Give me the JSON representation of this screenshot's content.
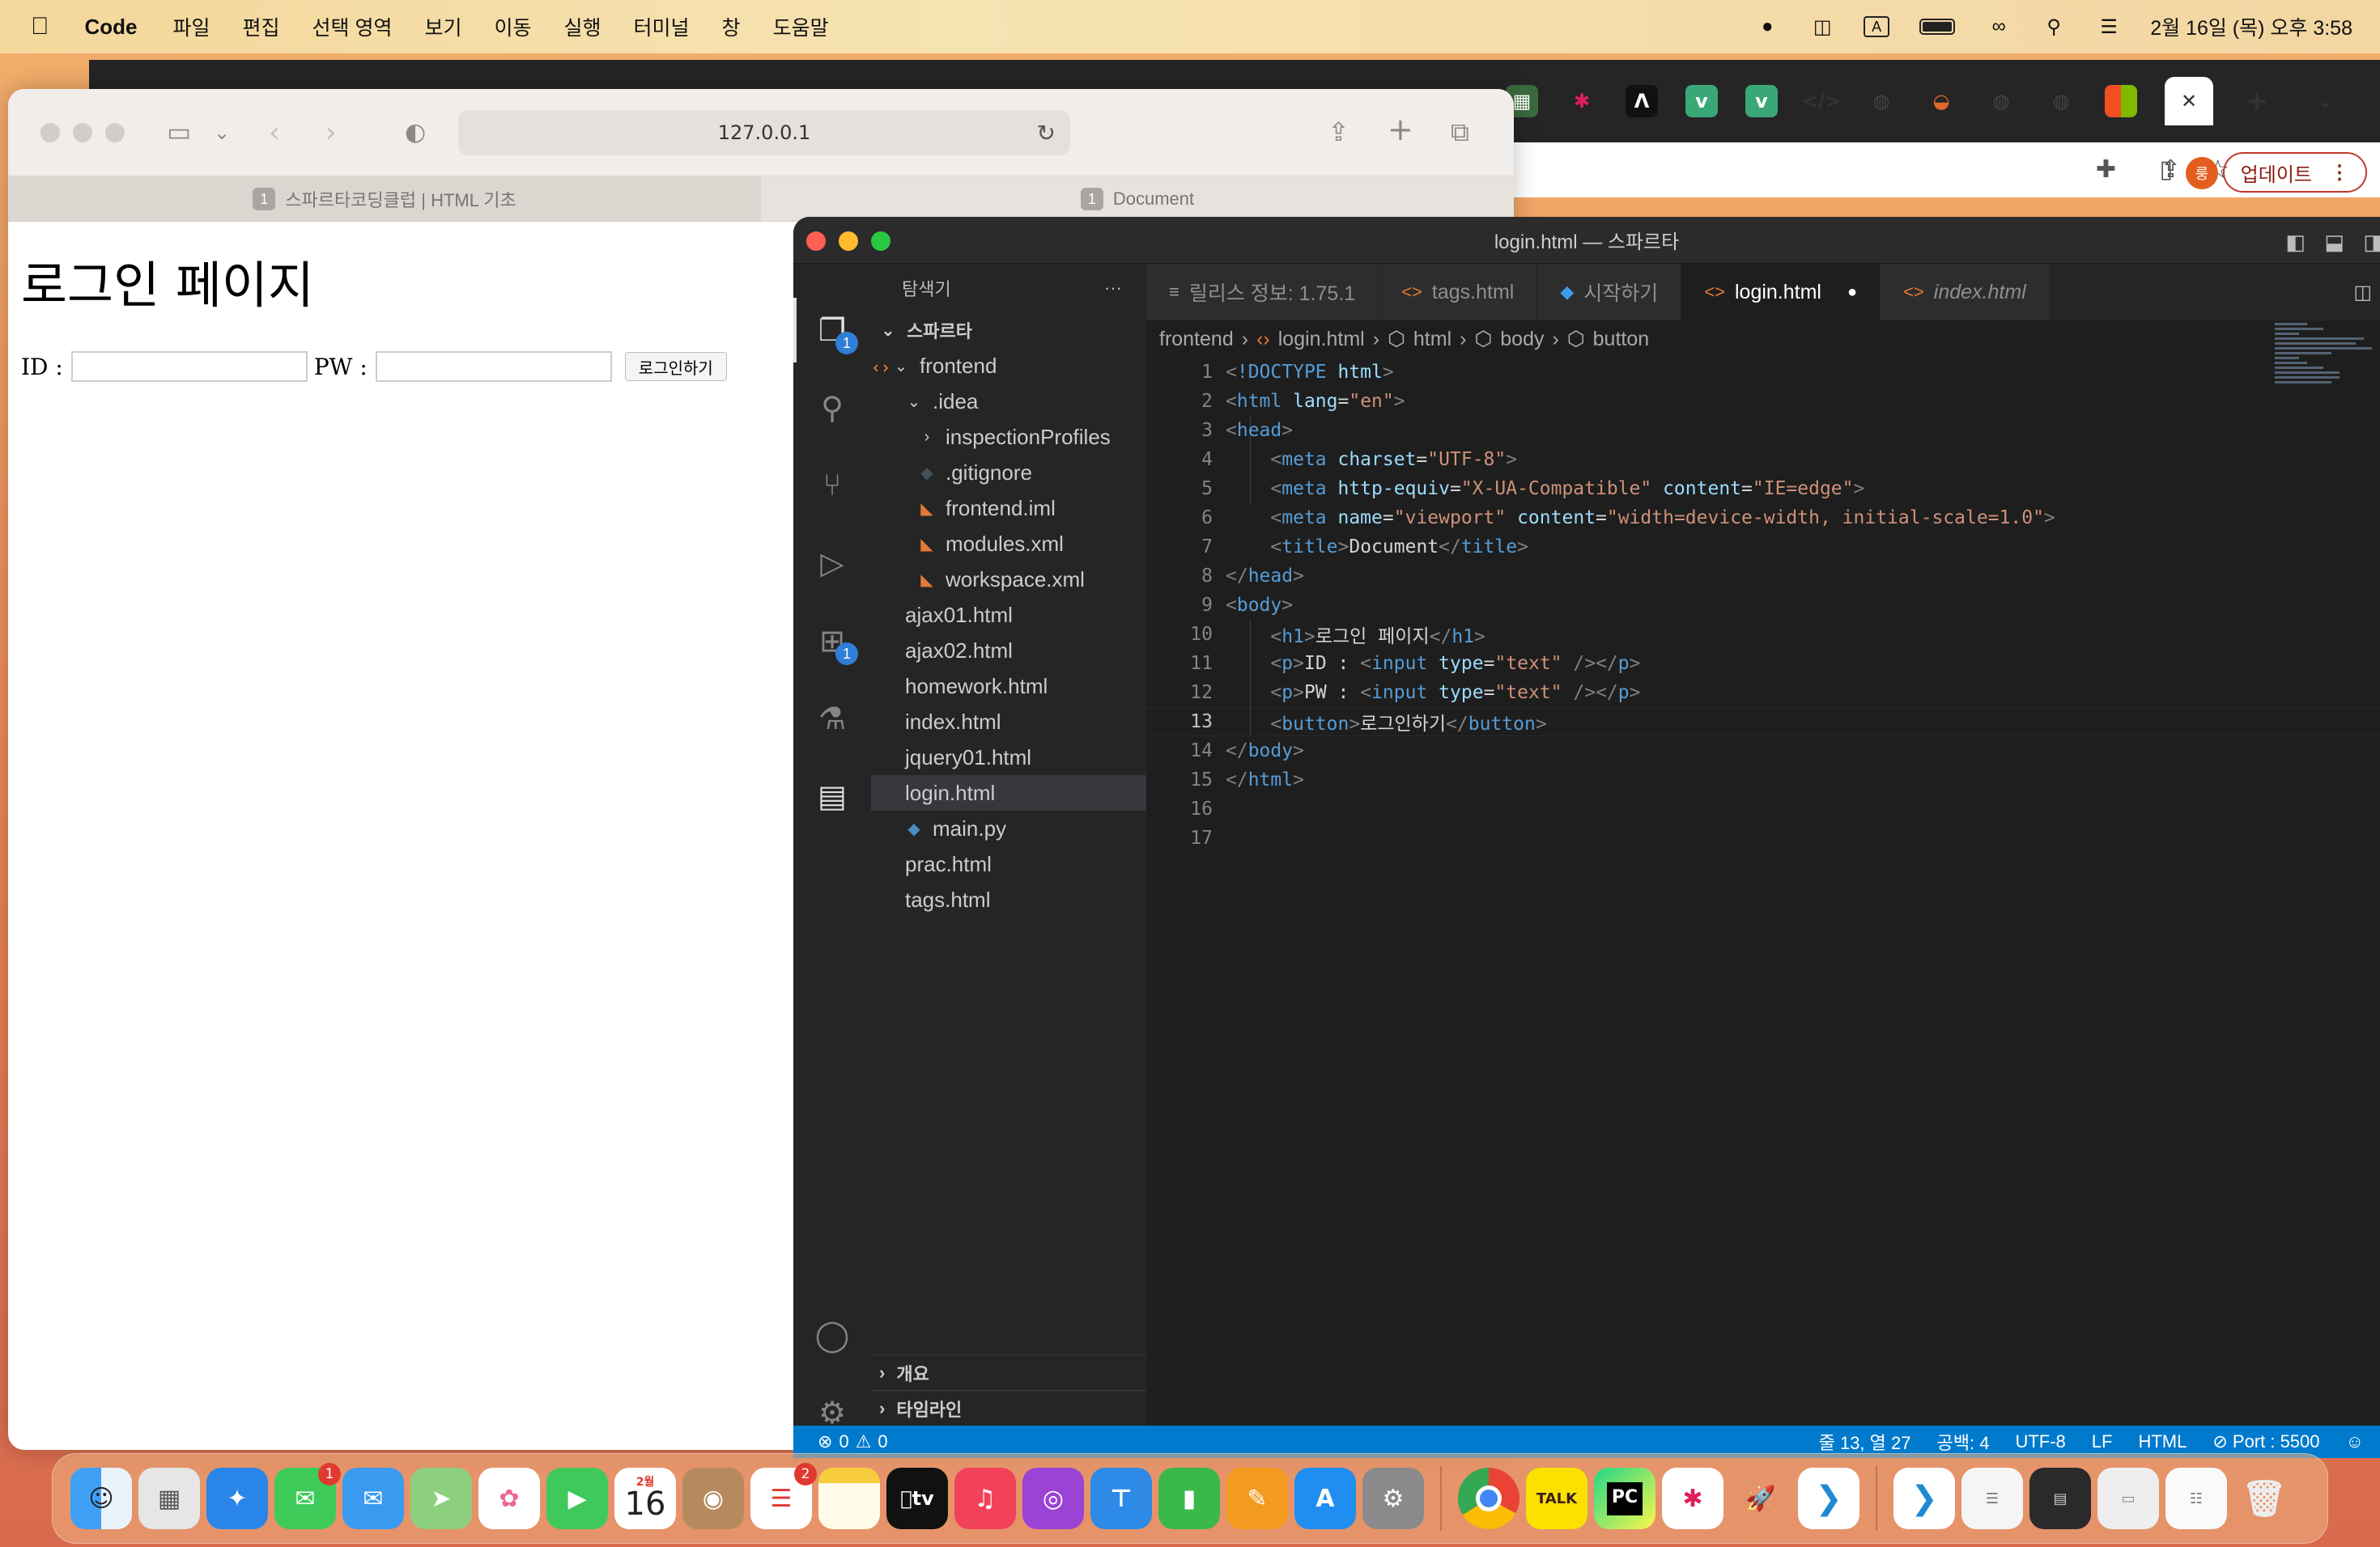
{
  "menubar": {
    "app_name": "Code",
    "items": [
      "파일",
      "편집",
      "선택 영역",
      "보기",
      "이동",
      "실행",
      "터미널",
      "창",
      "도움말"
    ],
    "input_indicator": "A",
    "datetime": "2월 16일 (목) 오후 3:58"
  },
  "chrome": {
    "update_label": "업데이트",
    "profile_initial": "룽"
  },
  "safari": {
    "address": "127.0.0.1",
    "tabs": [
      {
        "num": "1",
        "label": "스파르타코딩클럽 | HTML 기초"
      },
      {
        "num": "1",
        "label": "Document"
      }
    ],
    "page": {
      "heading": "로그인 페이지",
      "id_label": "ID :",
      "pw_label": "PW :",
      "button_label": "로그인하기"
    }
  },
  "vscode": {
    "window_title": "login.html — 스파르타",
    "explorer_title": "탐색기",
    "explorer_more": "···",
    "workspace": "스파르타",
    "tree": [
      {
        "label": "frontend",
        "type": "folder-open",
        "indent": 1
      },
      {
        "label": ".idea",
        "type": "folder-open",
        "indent": 2
      },
      {
        "label": "inspectionProfiles",
        "type": "folder",
        "indent": 3
      },
      {
        "label": ".gitignore",
        "type": "git",
        "indent": 3
      },
      {
        "label": "frontend.iml",
        "type": "rss",
        "indent": 3
      },
      {
        "label": "modules.xml",
        "type": "rss",
        "indent": 3
      },
      {
        "label": "workspace.xml",
        "type": "rss",
        "indent": 3
      },
      {
        "label": "ajax01.html",
        "type": "code",
        "indent": 2
      },
      {
        "label": "ajax02.html",
        "type": "code",
        "indent": 2
      },
      {
        "label": "homework.html",
        "type": "code",
        "indent": 2
      },
      {
        "label": "index.html",
        "type": "code",
        "indent": 2
      },
      {
        "label": "jquery01.html",
        "type": "code",
        "indent": 2
      },
      {
        "label": "login.html",
        "type": "code",
        "indent": 2,
        "selected": true
      },
      {
        "label": "main.py",
        "type": "py",
        "indent": 2
      },
      {
        "label": "prac.html",
        "type": "code",
        "indent": 2
      },
      {
        "label": "tags.html",
        "type": "code",
        "indent": 2
      }
    ],
    "sections": [
      "개요",
      "타임라인"
    ],
    "activity_badges": {
      "explorer": "1",
      "extensions": "1"
    },
    "tabs": [
      {
        "label": "릴리스 정보: 1.75.1",
        "icon": "≡"
      },
      {
        "label": "tags.html",
        "icon": "<>"
      },
      {
        "label": "시작하기",
        "icon": "◆"
      },
      {
        "label": "login.html",
        "icon": "<>",
        "active": true,
        "dirty": "●"
      },
      {
        "label": "index.html",
        "icon": "<>"
      }
    ],
    "breadcrumb": [
      "frontend",
      "login.html",
      "html",
      "body",
      "button"
    ],
    "current_line": "13",
    "lines": [
      {
        "n": "1",
        "parts": [
          [
            "p",
            "<"
          ],
          [
            "t",
            "!DOCTYPE"
          ],
          [
            "a",
            " html"
          ],
          [
            "p",
            ">"
          ]
        ]
      },
      {
        "n": "2",
        "parts": [
          [
            "p",
            "<"
          ],
          [
            "t",
            "html"
          ],
          [
            "a",
            " lang"
          ],
          [
            "d",
            "="
          ],
          [
            "s",
            "\"en\""
          ],
          [
            "p",
            ">"
          ]
        ]
      },
      {
        "n": "3",
        "parts": [
          [
            "p",
            "<"
          ],
          [
            "t",
            "head"
          ],
          [
            "p",
            ">"
          ]
        ]
      },
      {
        "n": "4",
        "parts": [
          [
            "d",
            "    "
          ],
          [
            "p",
            "<"
          ],
          [
            "t",
            "meta"
          ],
          [
            "a",
            " charset"
          ],
          [
            "d",
            "="
          ],
          [
            "s",
            "\"UTF-8\""
          ],
          [
            "p",
            ">"
          ]
        ]
      },
      {
        "n": "5",
        "parts": [
          [
            "d",
            "    "
          ],
          [
            "p",
            "<"
          ],
          [
            "t",
            "meta"
          ],
          [
            "a",
            " http-equiv"
          ],
          [
            "d",
            "="
          ],
          [
            "s",
            "\"X-UA-Compatible\""
          ],
          [
            "a",
            " content"
          ],
          [
            "d",
            "="
          ],
          [
            "s",
            "\"IE=edge\""
          ],
          [
            "p",
            ">"
          ]
        ]
      },
      {
        "n": "6",
        "parts": [
          [
            "d",
            "    "
          ],
          [
            "p",
            "<"
          ],
          [
            "t",
            "meta"
          ],
          [
            "a",
            " name"
          ],
          [
            "d",
            "="
          ],
          [
            "s",
            "\"viewport\""
          ],
          [
            "a",
            " content"
          ],
          [
            "d",
            "="
          ],
          [
            "s",
            "\"width=device-width, initial-scale=1.0\""
          ],
          [
            "p",
            ">"
          ]
        ]
      },
      {
        "n": "7",
        "parts": [
          [
            "d",
            "    "
          ],
          [
            "p",
            "<"
          ],
          [
            "t",
            "title"
          ],
          [
            "p",
            ">"
          ],
          [
            "d",
            "Document"
          ],
          [
            "p",
            "</"
          ],
          [
            "t",
            "title"
          ],
          [
            "p",
            ">"
          ]
        ]
      },
      {
        "n": "8",
        "parts": [
          [
            "p",
            "</"
          ],
          [
            "t",
            "head"
          ],
          [
            "p",
            ">"
          ]
        ]
      },
      {
        "n": "9",
        "parts": [
          [
            "p",
            "<"
          ],
          [
            "t",
            "body"
          ],
          [
            "p",
            ">"
          ]
        ]
      },
      {
        "n": "10",
        "parts": [
          [
            "d",
            "    "
          ],
          [
            "p",
            "<"
          ],
          [
            "t",
            "h1"
          ],
          [
            "p",
            ">"
          ],
          [
            "d",
            "로그인 페이지"
          ],
          [
            "p",
            "</"
          ],
          [
            "t",
            "h1"
          ],
          [
            "p",
            ">"
          ]
        ]
      },
      {
        "n": "11",
        "parts": [
          [
            "d",
            "    "
          ],
          [
            "p",
            "<"
          ],
          [
            "t",
            "p"
          ],
          [
            "p",
            ">"
          ],
          [
            "d",
            "ID : "
          ],
          [
            "p",
            "<"
          ],
          [
            "t",
            "input"
          ],
          [
            "a",
            " type"
          ],
          [
            "d",
            "="
          ],
          [
            "s",
            "\"text\""
          ],
          [
            "p",
            " /></"
          ],
          [
            "t",
            "p"
          ],
          [
            "p",
            ">"
          ]
        ]
      },
      {
        "n": "12",
        "parts": [
          [
            "d",
            "    "
          ],
          [
            "p",
            "<"
          ],
          [
            "t",
            "p"
          ],
          [
            "p",
            ">"
          ],
          [
            "d",
            "PW : "
          ],
          [
            "p",
            "<"
          ],
          [
            "t",
            "input"
          ],
          [
            "a",
            " type"
          ],
          [
            "d",
            "="
          ],
          [
            "s",
            "\"text\""
          ],
          [
            "p",
            " /></"
          ],
          [
            "t",
            "p"
          ],
          [
            "p",
            ">"
          ]
        ]
      },
      {
        "n": "13",
        "parts": [
          [
            "d",
            "    "
          ],
          [
            "p",
            "<"
          ],
          [
            "t",
            "button"
          ],
          [
            "p",
            ">"
          ],
          [
            "d",
            "로그인하기"
          ],
          [
            "p",
            "</"
          ],
          [
            "t",
            "button"
          ],
          [
            "p",
            ">"
          ]
        ]
      },
      {
        "n": "14",
        "parts": [
          [
            "p",
            "</"
          ],
          [
            "t",
            "body"
          ],
          [
            "p",
            ">"
          ]
        ]
      },
      {
        "n": "15",
        "parts": [
          [
            "p",
            "</"
          ],
          [
            "t",
            "html"
          ],
          [
            "p",
            ">"
          ]
        ]
      },
      {
        "n": "16",
        "parts": []
      },
      {
        "n": "17",
        "parts": []
      }
    ],
    "status": {
      "errors": "0",
      "warnings": "0",
      "position": "줄 13, 열 27",
      "spaces": "공백: 4",
      "encoding": "UTF-8",
      "eol": "LF",
      "language": "HTML",
      "port": "Port : 5500"
    }
  },
  "dock": {
    "calendar_month": "2월",
    "calendar_day": "16",
    "messages_badge": "1",
    "reminders_badge": "2",
    "appletv_label": "tv",
    "kakao_label": "TALK",
    "pycharm_label": "PC"
  }
}
